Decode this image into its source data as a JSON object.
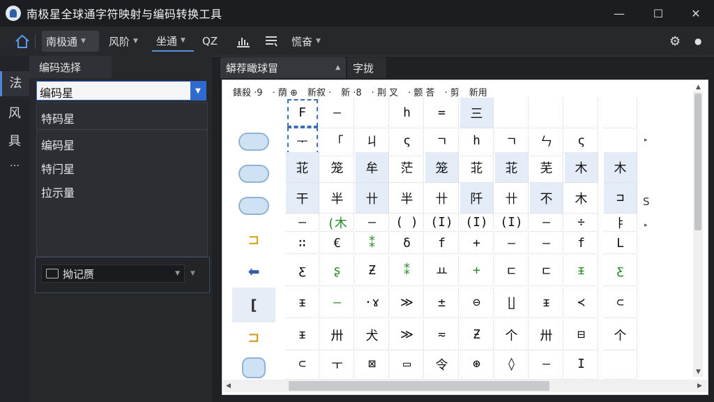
{
  "window": {
    "title": "南极星全球通字符映射与编码转换工具",
    "minimize": "—",
    "maximize": "☐",
    "close": "✕"
  },
  "toolbar": {
    "home_icon": "house-icon",
    "items": [
      {
        "label": "南极通",
        "has_dropdown": true,
        "selected": true
      },
      {
        "label": "风阶",
        "has_dropdown": true
      },
      {
        "label": "坐通",
        "has_dropdown": true,
        "underlined": true
      },
      {
        "label": "QZ"
      },
      {
        "label": "慌奋",
        "has_dropdown": true
      }
    ],
    "chart_icon": "chart-icon",
    "list_icon": "list-icon",
    "settings_icon": "gear-icon",
    "dot_icon": "dot-icon"
  },
  "leftbar": {
    "items": [
      "法",
      "风",
      "具",
      "…"
    ]
  },
  "left_panel": {
    "tab_label": "编码选择",
    "combo_value": "编码星",
    "dropdown_items": [
      "特码星",
      "编码星",
      "特闩星",
      "拉示量"
    ],
    "lower_combo_value": "拗记赝"
  },
  "doc_tabs": [
    {
      "label": "蟒荐瞰球冒",
      "active": true
    },
    {
      "label": "字拢",
      "active": false
    }
  ],
  "grid": {
    "column_header": [
      "錶殺 ·9",
      "· 荫 ⊕",
      "新叙 ·",
      "新 ·8",
      "·  荆 叉",
      "· 颤 荅",
      "· 剪",
      "新用"
    ],
    "rows": [
      [
        "F",
        "—",
        "",
        "h",
        "=",
        "三",
        "",
        "",
        "",
        ""
      ],
      [
        "ᅮ",
        "「",
        "ㄐ",
        "ς",
        "ㄱ",
        "h",
        "ㄱ",
        "ㄣ",
        "ς",
        ""
      ],
      [
        "苝",
        "笼",
        "牟",
        "茫",
        "笼",
        "苝",
        "苝",
        "芜",
        "木",
        "木"
      ],
      [
        "干",
        "半",
        "卄",
        "半",
        "卄",
        "阡",
        "卄",
        "不",
        "木",
        "⊐"
      ],
      [
        "—",
        "(木",
        "—",
        "( )",
        "(I)",
        "(I)",
        "(I)",
        "—",
        "÷",
        "ㅑ"
      ],
      [
        "∷",
        "€",
        "⁑",
        "δ",
        "f",
        "+",
        "—",
        "—",
        "f",
        "L"
      ],
      [
        "ƹ",
        "ʂ",
        "Ƶ",
        "⁑",
        "ㅛ",
        "+",
        "ㄷ",
        "ㄷ",
        "ᵻ",
        "ƹ"
      ],
      [
        "ᵻ",
        "—",
        "·ɤ",
        "≫",
        "±",
        "⊖",
        "∐",
        "ᵻ",
        "≺",
        "⊂"
      ],
      [
        "ᵻ",
        "卅",
        "犬",
        "≫",
        "≂",
        "Ƶ",
        "个",
        "卅",
        "⊟",
        "个"
      ],
      [
        "⊂",
        "ㅜ",
        "⊠",
        "▭",
        "令",
        "⊛",
        "◊",
        "—",
        "I",
        ""
      ]
    ]
  },
  "row_icons": [
    "cloud-icon",
    "cloud-icon",
    "cloud-icon",
    "yellow-glyph-icon",
    "blue-arrow-icon",
    "bracket-icon",
    "yellow-box-icon",
    "ice-icon"
  ]
}
